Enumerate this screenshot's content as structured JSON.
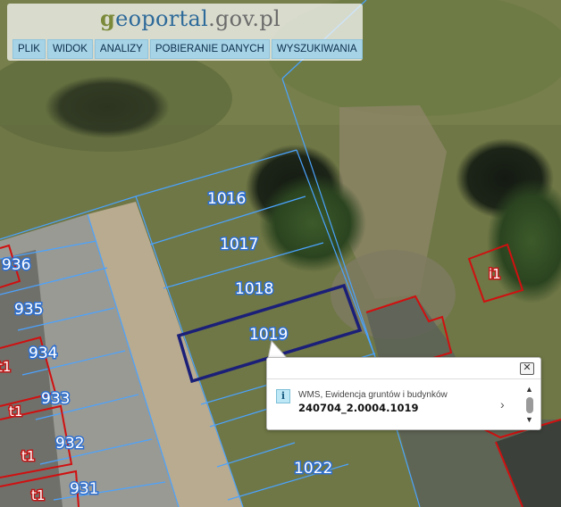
{
  "header": {
    "logo": {
      "g": "g",
      "main": "eoportal",
      "domain": ".gov.pl"
    },
    "menu": [
      "PLIK",
      "WIDOK",
      "ANALIZY",
      "POBIERANIE DANYCH",
      "WYSZUKIWANIA"
    ]
  },
  "map": {
    "parcels": [
      "1016",
      "1017",
      "1018",
      "1019",
      "1022",
      "936",
      "935",
      "934",
      "933",
      "932",
      "931"
    ],
    "building_labels": [
      "i1",
      "t1",
      "t1",
      "t1",
      "t1"
    ],
    "colors": {
      "parcel_line": "#4aa3ff",
      "selected_parcel": "#1b1f78",
      "building_line": "#d01010"
    }
  },
  "popup": {
    "source": "WMS, Ewidencja gruntów i budynków",
    "parcel_id": "240704_2.0004.1019",
    "close_icon": "close-icon",
    "expand_icon": "chevron-right-icon"
  }
}
